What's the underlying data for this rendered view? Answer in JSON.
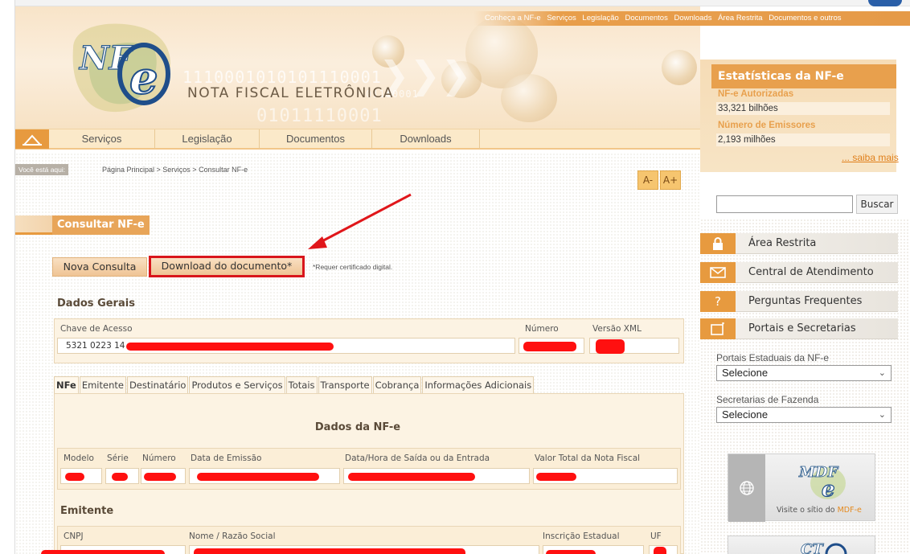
{
  "top_links": [
    "Conheça a NF-e",
    "Serviços",
    "Legislação",
    "Documentos",
    "Downloads",
    "Área Restrita",
    "Documentos e outros"
  ],
  "header": {
    "logo_text": "NF e",
    "brand_text": "NOTA FISCAL ELETRÔNICA",
    "binary_1": "1110001010101110001",
    "binary_2": "01011110001",
    "binary_3": "01110001"
  },
  "nav": {
    "items": [
      "Serviços",
      "Legislação",
      "Documentos",
      "Downloads"
    ]
  },
  "breadcrumb": {
    "label": "Você está aqui:",
    "path": "Página Principal > Serviços > Consultar NF-e"
  },
  "font_buttons": {
    "decrease": "A-",
    "increase": "A+"
  },
  "page_title": "Consultar NF-e",
  "actions": {
    "nova_consulta": "Nova Consulta",
    "download": "Download do documento*",
    "note": "*Requer certificado digital."
  },
  "dados_gerais": {
    "title": "Dados Gerais",
    "chave_label": "Chave de Acesso",
    "chave_value": "5321 0223 14",
    "numero_label": "Número",
    "versao_label": "Versão XML"
  },
  "tabs": [
    "NFe",
    "Emitente",
    "Destinatário",
    "Produtos e Serviços",
    "Totais",
    "Transporte",
    "Cobrança",
    "Informações Adicionais"
  ],
  "dados_nfe": {
    "title": "Dados da NF-e",
    "columns": [
      "Modelo",
      "Série",
      "Número",
      "Data de Emissão",
      "Data/Hora de Saída ou da Entrada",
      "Valor Total da Nota Fiscal"
    ]
  },
  "emitente": {
    "title": "Emitente",
    "columns": [
      "CNPJ",
      "Nome / Razão Social",
      "Inscrição Estadual",
      "UF"
    ]
  },
  "sidebar": {
    "stats_title": "Estatísticas da NF-e",
    "autorizadas_label": "NF-e Autorizadas",
    "autorizadas_value": "33,321 bilhões",
    "emissores_label": "Número de Emissores",
    "emissores_value": "2,193 milhões",
    "saiba_mais": "... saiba mais",
    "search_button": "Buscar",
    "menu": [
      {
        "label": "Área Restrita",
        "icon": "lock-icon"
      },
      {
        "label": "Central de Atendimento",
        "icon": "envelope-icon"
      },
      {
        "label": "Perguntas Frequentes",
        "icon": "question-icon"
      },
      {
        "label": "Portais e Secretarias",
        "icon": "window-icon"
      }
    ],
    "portais_label": "Portais Estaduais da NF-e",
    "portais_value": "Selecione",
    "secretarias_label": "Secretarias de Fazenda",
    "secretarias_value": "Selecione",
    "mdfe_logo": "MDF e",
    "mdfe_caption_prefix": "Visite o sítio do ",
    "mdfe_caption_link": "MDF-e",
    "cte_logo": "CT e"
  },
  "colors": {
    "accent_orange": "#e79a3f",
    "highlight_red": "#d8151b",
    "redaction_red": "#ff1010"
  }
}
